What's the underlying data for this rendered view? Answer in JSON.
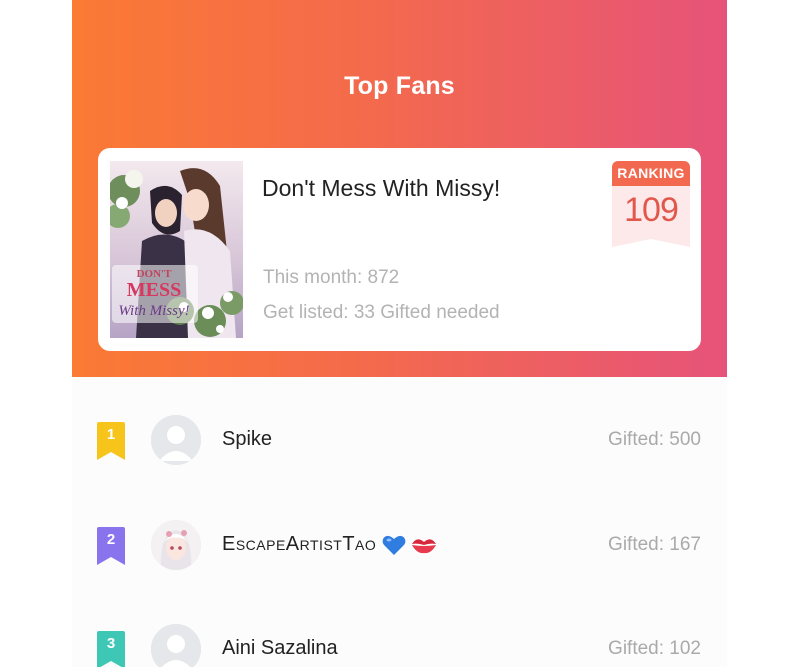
{
  "header": {
    "title": "Top Fans"
  },
  "book_card": {
    "cover_alt": "Don't Mess With Missy! cover",
    "cover_text": [
      "DON'T",
      "MESS",
      "With Missy!"
    ],
    "title": "Don't Mess With Missy!",
    "this_month": "This month: 872",
    "get_listed": "Get listed: 33 Gifted needed",
    "ranking_label": "RANKING",
    "ranking_value": "109"
  },
  "fans": [
    {
      "rank": "1",
      "name": "Spike",
      "gifted": "Gifted: 500",
      "medal_color": "#f7c41b",
      "avatar": "default-avatar"
    },
    {
      "rank": "2",
      "name": "EscapeArtistTao",
      "gifted": "Gifted: 167",
      "medal_color": "#8a74ee",
      "avatar": "anime-girl-avatar",
      "emojis": [
        "blue-heart-icon",
        "kiss-mark-icon"
      ]
    },
    {
      "rank": "3",
      "name": "Aini Sazalina",
      "gifted": "Gifted: 102",
      "medal_color": "#3fc7b6",
      "avatar": "default-avatar"
    }
  ]
}
